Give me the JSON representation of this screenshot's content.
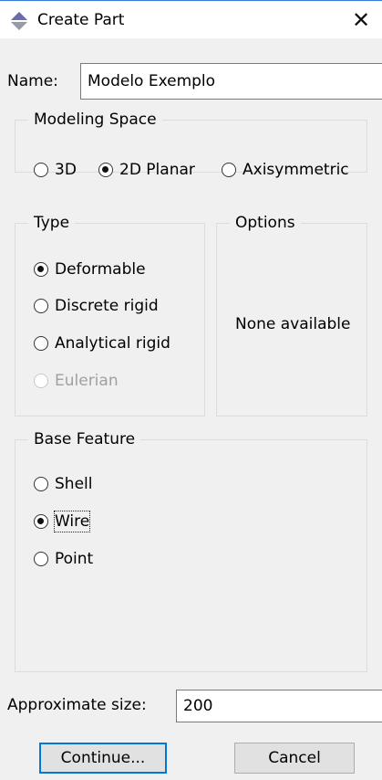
{
  "window": {
    "title": "Create Part",
    "close_glyph": "✕"
  },
  "name_field": {
    "label": "Name:",
    "value": "Modelo Exemplo"
  },
  "modeling_space": {
    "legend": "Modeling Space",
    "options": [
      {
        "label": "3D",
        "selected": false
      },
      {
        "label": "2D Planar",
        "selected": true
      },
      {
        "label": "Axisymmetric",
        "selected": false
      }
    ]
  },
  "type": {
    "legend": "Type",
    "options": [
      {
        "label": "Deformable",
        "selected": true,
        "enabled": true
      },
      {
        "label": "Discrete rigid",
        "selected": false,
        "enabled": true
      },
      {
        "label": "Analytical rigid",
        "selected": false,
        "enabled": true
      },
      {
        "label": "Eulerian",
        "selected": false,
        "enabled": false
      }
    ]
  },
  "options": {
    "legend": "Options",
    "message": "None available"
  },
  "base_feature": {
    "legend": "Base Feature",
    "options": [
      {
        "label": "Shell",
        "selected": false
      },
      {
        "label": "Wire",
        "selected": true
      },
      {
        "label": "Point",
        "selected": false
      }
    ]
  },
  "approximate_size": {
    "label": "Approximate size:",
    "value": "200"
  },
  "buttons": {
    "continue": "Continue...",
    "cancel": "Cancel"
  },
  "colors": {
    "accent": "#0078d7",
    "window_bg": "#f0f0f0"
  },
  "icons": {
    "title": "create-part-icon",
    "close": "close-icon"
  }
}
